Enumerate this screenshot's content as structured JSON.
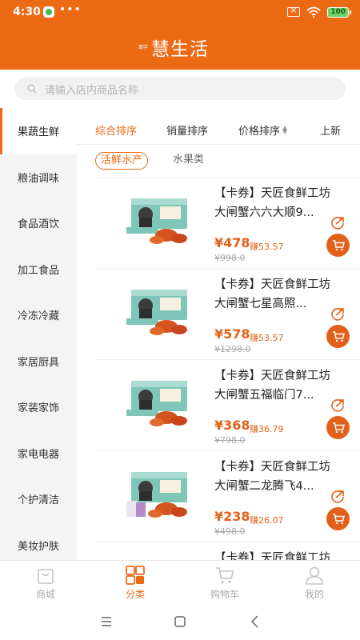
{
  "status_bar": {
    "time": "4:30",
    "dots": "•••",
    "battery": "100"
  },
  "header": {
    "logo_mark": "寰宇",
    "logo_text": "慧生活",
    "accent": "#ec6a14"
  },
  "search": {
    "placeholder": "请输入店内商品名称"
  },
  "sidebar": {
    "items": [
      {
        "label": "果蔬生鲜",
        "active": true
      },
      {
        "label": "粮油调味"
      },
      {
        "label": "食品酒饮"
      },
      {
        "label": "加工食品"
      },
      {
        "label": "冷冻冷藏"
      },
      {
        "label": "家居厨具"
      },
      {
        "label": "家装家饰"
      },
      {
        "label": "家电电器"
      },
      {
        "label": "个护清洁"
      },
      {
        "label": "美妆护肤"
      }
    ]
  },
  "sort": {
    "comprehensive": "综合排序",
    "sales": "销量排序",
    "price": "价格排序",
    "new": "上新"
  },
  "subtabs": {
    "active": "活鲜水产",
    "inactive": "水果类"
  },
  "products": [
    {
      "title": "【卡券】天匠食鲜工坊大闸蟹六六大顺9...",
      "price": "¥478",
      "earn": "赚53.57",
      "original": "¥998.0"
    },
    {
      "title": "【卡券】天匠食鲜工坊大闸蟹七星高照...",
      "price": "¥578",
      "earn": "赚53.57",
      "original": "¥1298.0"
    },
    {
      "title": "【卡券】天匠食鲜工坊大闸蟹五福临门7...",
      "price": "¥368",
      "earn": "赚36.79",
      "original": "¥798.0"
    },
    {
      "title": "【卡券】天匠食鲜工坊大闸蟹二龙腾飞4...",
      "price": "¥238",
      "earn": "赚26.07",
      "original": "¥498.0"
    },
    {
      "title": "【卡券】天匠食鲜工坊大闸蟹",
      "price": "",
      "earn": "",
      "original": ""
    }
  ],
  "bottom_nav": {
    "mall": "商城",
    "category": "分类",
    "cart": "购物车",
    "mine": "我的"
  }
}
